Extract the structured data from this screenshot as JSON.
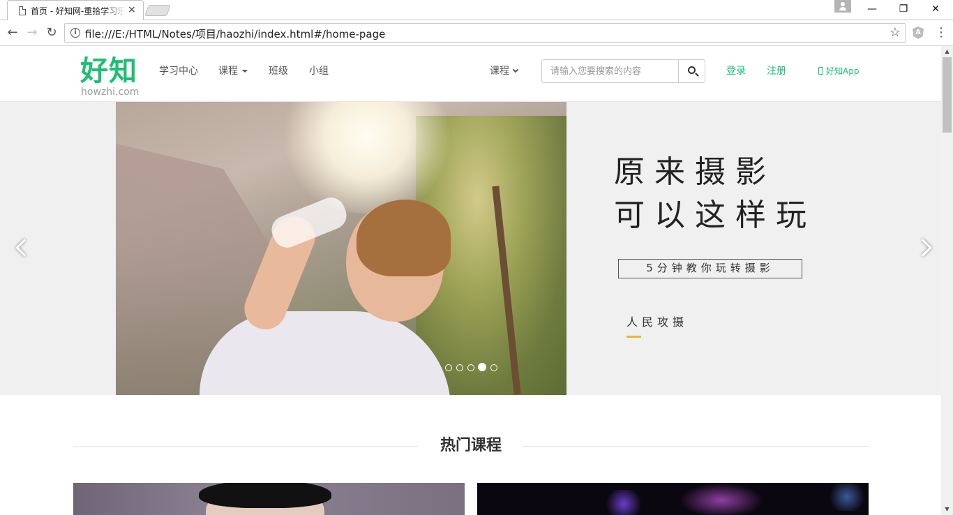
{
  "browser": {
    "tab_title": "首页 - 好知网-重拾学习乐趣",
    "tab_close": "×",
    "url": "file:///E:/HTML/Notes/项目/haozhi/index.html#/home-page",
    "back_glyph": "←",
    "forward_glyph": "→",
    "reload_glyph": "↻",
    "star_glyph": "☆",
    "menu_glyph": "⋮",
    "minimize_glyph": "—",
    "restore_glyph": "❐",
    "close_glyph": "✕",
    "info_glyph": "i"
  },
  "site": {
    "logo_cn": "好知",
    "logo_en": "howzhi.com",
    "nav": [
      {
        "label": "学习中心"
      },
      {
        "label": "课程",
        "dropdown": true
      },
      {
        "label": "班级"
      },
      {
        "label": "小组"
      }
    ],
    "category_dropdown": "课程",
    "search_placeholder": "请输入您要搜索的内容",
    "login": "登录",
    "register": "注册",
    "app_link": "好知App",
    "brand_color": "#1dbf73"
  },
  "carousel": {
    "title_line1": "原来摄影",
    "title_line2": "可以这样玩",
    "subtitle": "5分钟教你玩转摄影",
    "brand": "人民攻摄",
    "indicator_count": 5,
    "active_index": 3,
    "accent_color": "#e8b92c"
  },
  "section": {
    "hot_courses_title": "热门课程"
  }
}
